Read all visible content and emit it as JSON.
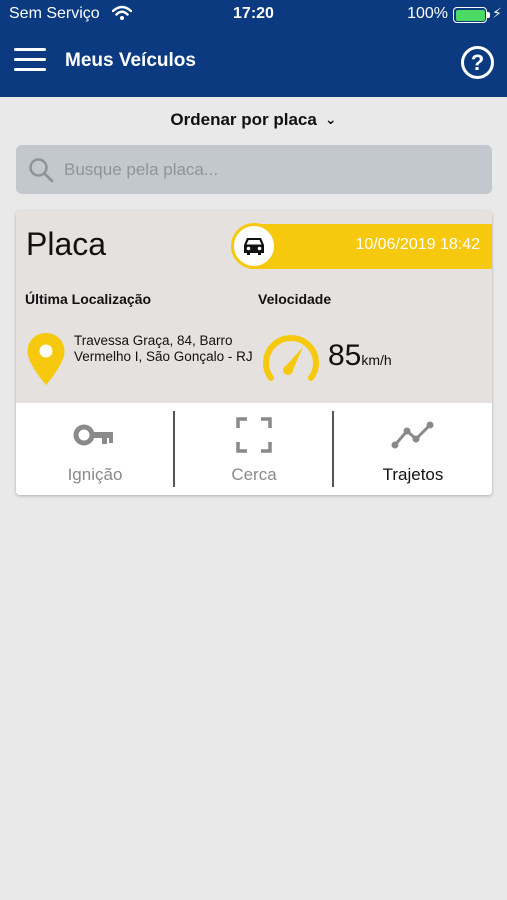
{
  "status_bar": {
    "carrier": "Sem Serviço",
    "time": "17:20",
    "battery": "100%"
  },
  "header": {
    "title": "Meus Veículos",
    "help": "?"
  },
  "sort": {
    "label": "Ordenar por placa"
  },
  "search": {
    "placeholder": "Busque pela placa..."
  },
  "vehicle": {
    "plate": "Placa",
    "datetime": "10/06/2019 18:42",
    "location_label": "Última Localização",
    "address": "Travessa Graça, 84, Barro Vermelho I, São Gonçalo - RJ",
    "speed_label": "Velocidade",
    "speed_value": "85",
    "speed_unit": "km/h"
  },
  "actions": [
    {
      "label": "Ignição",
      "icon": "key-icon",
      "active": false
    },
    {
      "label": "Cerca",
      "icon": "fence-icon",
      "active": false
    },
    {
      "label": "Trajetos",
      "icon": "route-icon",
      "active": true
    }
  ],
  "colors": {
    "header": "#0b3a80",
    "accent": "#f6c90e",
    "background": "#e9e9e9",
    "inactive": "#8a8a8a"
  }
}
